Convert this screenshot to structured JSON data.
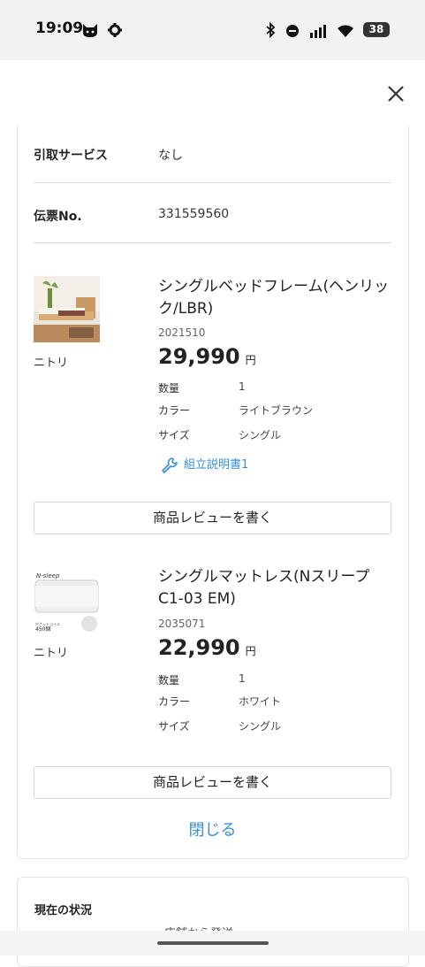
{
  "status_bar": {
    "time": "19:09",
    "battery": "38",
    "left_icons": [
      "cat-icon",
      "gear-icon"
    ],
    "right_icons": [
      "bluetooth-icon",
      "dnd-icon",
      "signal-icon",
      "wifi-icon",
      "battery-icon"
    ]
  },
  "header": {
    "close_icon": "close-icon"
  },
  "order_info": {
    "pickup_label": "引取サービス",
    "pickup_value": "なし",
    "slip_label": "伝票No.",
    "slip_value": "331559560"
  },
  "products": [
    {
      "brand": "ニトリ",
      "name": "シングルベッドフレーム(ヘンリック/LBR)",
      "code": "2021510",
      "price": "29,990",
      "unit": "円",
      "attrs": [
        {
          "k": "数量",
          "v": "1"
        },
        {
          "k": "カラー",
          "v": "ライトブラウン"
        },
        {
          "k": "サイズ",
          "v": "シングル"
        }
      ],
      "manual_link": "組立説明書1",
      "review_label": "商品レビューを書く"
    },
    {
      "brand": "ニトリ",
      "name": "シングルマットレス(Nスリープ C1-03 EM)",
      "code": "2035071",
      "price": "22,990",
      "unit": "円",
      "attrs": [
        {
          "k": "数量",
          "v": "1"
        },
        {
          "k": "カラー",
          "v": "ホワイト"
        },
        {
          "k": "サイズ",
          "v": "シングル"
        }
      ],
      "review_label": "商品レビューを書く",
      "image_text": {
        "logo": "N-sleep",
        "caption": "ポケットコイル",
        "count": "450個"
      }
    }
  ],
  "close_label": "閉じる",
  "current_status": {
    "title": "現在の状況",
    "partial_text": "店舗から発送"
  },
  "colors": {
    "accent": "#3a8fd6",
    "text": "#222222",
    "border": "#dcdcdc"
  }
}
